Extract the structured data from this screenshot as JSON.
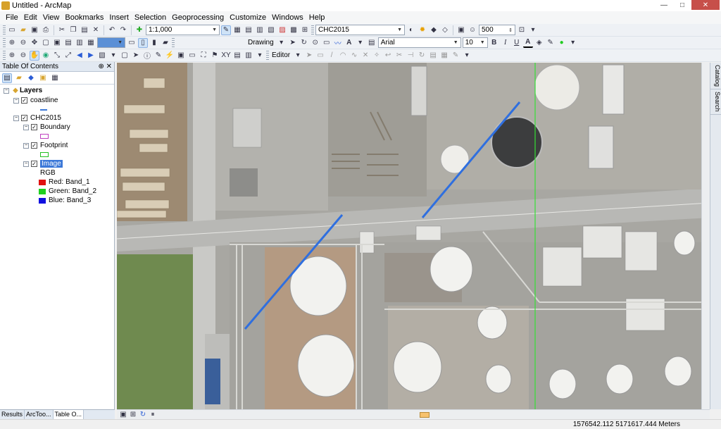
{
  "window": {
    "title": "Untitled - ArcMap",
    "minimize": "—",
    "maximize": "□",
    "close": "✕"
  },
  "menu": [
    "File",
    "Edit",
    "View",
    "Bookmarks",
    "Insert",
    "Selection",
    "Geoprocessing",
    "Customize",
    "Windows",
    "Help"
  ],
  "toolbar1": {
    "scale": "1:1,000",
    "layer_combo": "CHC2015",
    "sample_value": "500"
  },
  "toolbar2": {
    "drawing_label": "Drawing",
    "font": "Arial",
    "font_size": "10",
    "bold": "B",
    "italic": "I",
    "underline": "U",
    "text_tool": "A"
  },
  "toolbar3": {
    "editor_label": "Editor"
  },
  "toc": {
    "title": "Table Of Contents",
    "pin": "⊕",
    "close": "✕",
    "root": "Layers",
    "layers": [
      {
        "name": "coastline",
        "checked": true
      },
      {
        "name": "CHC2015",
        "checked": true
      },
      {
        "name": "Boundary",
        "checked": true
      },
      {
        "name": "Footprint",
        "checked": true
      },
      {
        "name": "Image",
        "checked": true,
        "selected": true
      }
    ],
    "rgb_label": "RGB",
    "bands": [
      {
        "channel": "Red:",
        "band": "Band_1",
        "color": "#e01010"
      },
      {
        "channel": "Green:",
        "band": "Band_2",
        "color": "#20d020"
      },
      {
        "channel": "Blue:",
        "band": "Band_3",
        "color": "#1010e0"
      }
    ],
    "swatch_colors": {
      "coastline": "#3b78d8",
      "boundary": "#c040c0",
      "footprint": "#20c020"
    }
  },
  "bottom_tabs": [
    "Results",
    "ArcToo...",
    "Table O..."
  ],
  "right_tabs": [
    "Catalog",
    "Search"
  ],
  "status": {
    "coords": "1576542.112  5171617.444 Meters"
  },
  "map_colors": {
    "line": "#2f6fdf",
    "footprint_line": "#35e035"
  }
}
